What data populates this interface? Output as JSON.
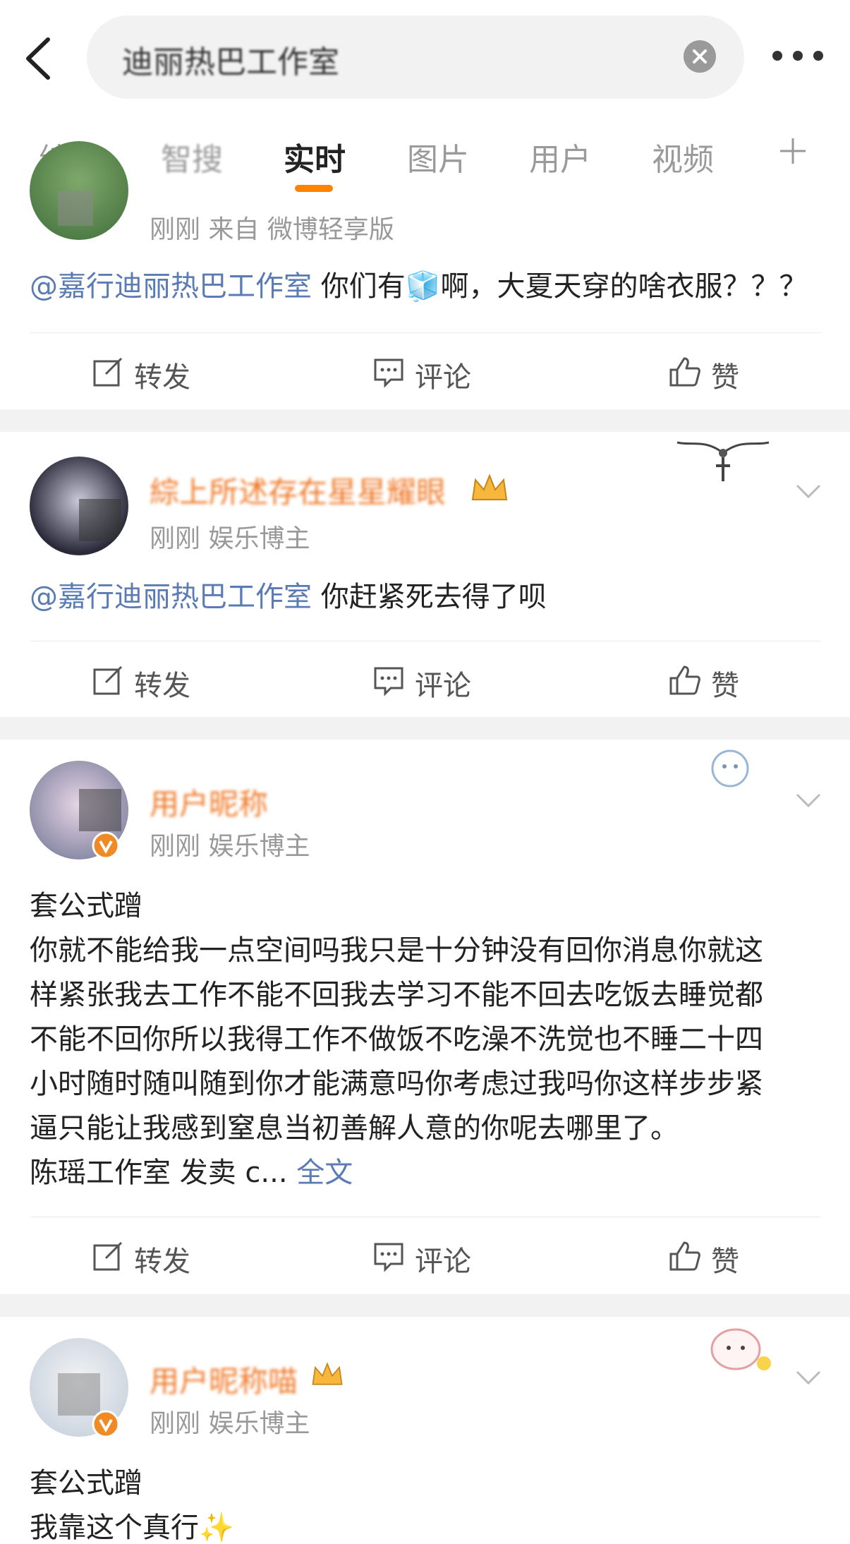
{
  "header": {
    "back_icon": "chevron-left-icon",
    "search_value": "迪丽热巴工作室",
    "clear_icon": "clear-x-icon",
    "more_icon": "more-dots-icon"
  },
  "tabs": [
    {
      "label": "综合",
      "active": false
    },
    {
      "label": "智搜",
      "active": false
    },
    {
      "label": "实时",
      "active": true
    },
    {
      "label": "图片",
      "active": false
    },
    {
      "label": "用户",
      "active": false
    },
    {
      "label": "视频",
      "active": false
    }
  ],
  "tab_add_icon": "plus-icon",
  "accent_color": "#ff8200",
  "posts": [
    {
      "meta": "刚刚  来自 微博轻享版",
      "mention": "@嘉行迪丽热巴工作室",
      "text": " 你们有🧊啊，大夏天穿的啥衣服？？？",
      "actions": {
        "repost": "转发",
        "comment": "评论",
        "like": "赞"
      }
    },
    {
      "username": "綜上所述存在星星耀眼",
      "meta": "刚刚  娱乐博主",
      "mention": "@嘉行迪丽热巴工作室",
      "text": " 你赶紧死去得了呗",
      "actions": {
        "repost": "转发",
        "comment": "评论",
        "like": "赞"
      }
    },
    {
      "username": "用户昵称",
      "meta": "刚刚  娱乐博主",
      "lines": [
        "套公式蹭",
        "你就不能给我一点空间吗我只是十分钟没有回你消息你就这",
        "样紧张我去工作不能不回我去学习不能不回去吃饭去睡觉都",
        "不能不回你所以我得工作不做饭不吃澡不洗觉也不睡二十四",
        "小时随时随叫随到你才能满意吗你考虑过我吗你这样步步紧",
        "逼只能让我感到窒息当初善解人意的你呢去哪里了。"
      ],
      "last_line": "陈瑶工作室 发卖 c... ",
      "full_text_link": "全文",
      "actions": {
        "repost": "转发",
        "comment": "评论",
        "like": "赞"
      }
    },
    {
      "username": "用户昵称喵",
      "meta": "刚刚  娱乐博主",
      "lines": [
        "套公式蹭",
        "我靠这个真行✨"
      ]
    }
  ]
}
